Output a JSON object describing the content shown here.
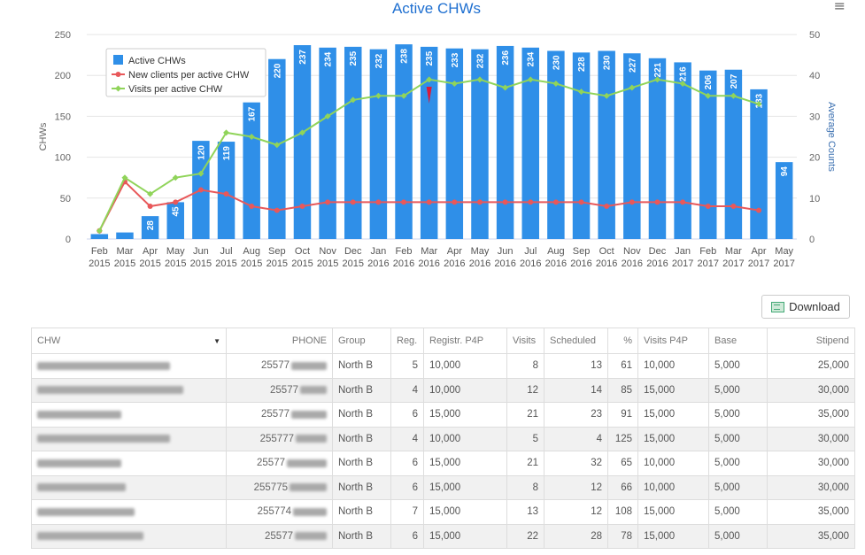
{
  "chart_data": {
    "type": "bar+line",
    "title": "Active CHWs",
    "categories": [
      "Feb 2015",
      "Mar 2015",
      "Apr 2015",
      "May 2015",
      "Jun 2015",
      "Jul 2015",
      "Aug 2015",
      "Sep 2015",
      "Oct 2015",
      "Nov 2015",
      "Dec 2015",
      "Jan 2016",
      "Feb 2016",
      "Mar 2016",
      "Apr 2016",
      "May 2016",
      "Jun 2016",
      "Jul 2016",
      "Aug 2016",
      "Sep 2016",
      "Oct 2016",
      "Nov 2016",
      "Dec 2016",
      "Jan 2017",
      "Feb 2017",
      "Mar 2017",
      "Apr 2017",
      "May 2017"
    ],
    "ylabel": "CHWs",
    "y2label": "Average Counts",
    "ylim": [
      0,
      250
    ],
    "y2lim": [
      0,
      50
    ],
    "yticks": [
      0,
      50,
      100,
      150,
      200,
      250
    ],
    "y2ticks": [
      0,
      10,
      20,
      30,
      40,
      50
    ],
    "grid": true,
    "legend_position": "top-left",
    "series": [
      {
        "name": "Active CHWs",
        "type": "bar",
        "axis": "left",
        "color": "#2f8fe8",
        "values": [
          6,
          8,
          28,
          45,
          120,
          119,
          167,
          220,
          237,
          234,
          235,
          232,
          238,
          235,
          233,
          232,
          236,
          234,
          230,
          228,
          230,
          227,
          221,
          216,
          206,
          207,
          183,
          94
        ],
        "labels": [
          "",
          "",
          "28",
          "45",
          "120",
          "119",
          "167",
          "220",
          "237",
          "234",
          "235",
          "232",
          "238",
          "235",
          "233",
          "232",
          "236",
          "234",
          "230",
          "228",
          "230",
          "227",
          "221",
          "216",
          "206",
          "207",
          "183",
          "94"
        ]
      },
      {
        "name": "New clients per active CHW",
        "type": "line",
        "axis": "right",
        "color": "#e8585a",
        "values": [
          2,
          14,
          8,
          9,
          12,
          11,
          8,
          7,
          8,
          9,
          9,
          9,
          9,
          9,
          9,
          9,
          9,
          9,
          9,
          9,
          8,
          9,
          9,
          9,
          8,
          8,
          7,
          null
        ]
      },
      {
        "name": "Visits per active CHW",
        "type": "line",
        "axis": "right",
        "color": "#90d45a",
        "values": [
          2,
          15,
          11,
          15,
          16,
          26,
          25,
          23,
          26,
          30,
          34,
          35,
          35,
          39,
          38,
          39,
          37,
          39,
          38,
          36,
          35,
          37,
          39,
          38,
          35,
          35,
          33,
          null
        ]
      }
    ]
  },
  "download_label": "Download",
  "table": {
    "columns": [
      "CHW",
      "PHONE",
      "Group",
      "Reg.",
      "Registr. P4P",
      "Visits",
      "Scheduled",
      "%",
      "Visits P4P",
      "Base",
      "Stipend"
    ],
    "rows": [
      {
        "phone": "25577",
        "group": "North B",
        "reg": "5",
        "registr_p4p": "10,000",
        "visits": "8",
        "scheduled": "13",
        "pct": "61",
        "visits_p4p": "10,000",
        "base": "5,000",
        "stipend": "25,000"
      },
      {
        "phone": "25577",
        "group": "North B",
        "reg": "4",
        "registr_p4p": "10,000",
        "visits": "12",
        "scheduled": "14",
        "pct": "85",
        "visits_p4p": "15,000",
        "base": "5,000",
        "stipend": "30,000"
      },
      {
        "phone": "25577",
        "group": "North B",
        "reg": "6",
        "registr_p4p": "15,000",
        "visits": "21",
        "scheduled": "23",
        "pct": "91",
        "visits_p4p": "15,000",
        "base": "5,000",
        "stipend": "35,000"
      },
      {
        "phone": "255777",
        "group": "North B",
        "reg": "4",
        "registr_p4p": "10,000",
        "visits": "5",
        "scheduled": "4",
        "pct": "125",
        "visits_p4p": "15,000",
        "base": "5,000",
        "stipend": "30,000"
      },
      {
        "phone": "25577",
        "group": "North B",
        "reg": "6",
        "registr_p4p": "15,000",
        "visits": "21",
        "scheduled": "32",
        "pct": "65",
        "visits_p4p": "10,000",
        "base": "5,000",
        "stipend": "30,000"
      },
      {
        "phone": "255775",
        "group": "North B",
        "reg": "6",
        "registr_p4p": "15,000",
        "visits": "8",
        "scheduled": "12",
        "pct": "66",
        "visits_p4p": "10,000",
        "base": "5,000",
        "stipend": "30,000"
      },
      {
        "phone": "255774",
        "group": "North B",
        "reg": "7",
        "registr_p4p": "15,000",
        "visits": "13",
        "scheduled": "12",
        "pct": "108",
        "visits_p4p": "15,000",
        "base": "5,000",
        "stipend": "35,000"
      },
      {
        "phone": "25577",
        "group": "North B",
        "reg": "6",
        "registr_p4p": "15,000",
        "visits": "22",
        "scheduled": "28",
        "pct": "78",
        "visits_p4p": "15,000",
        "base": "5,000",
        "stipend": "35,000"
      }
    ]
  }
}
